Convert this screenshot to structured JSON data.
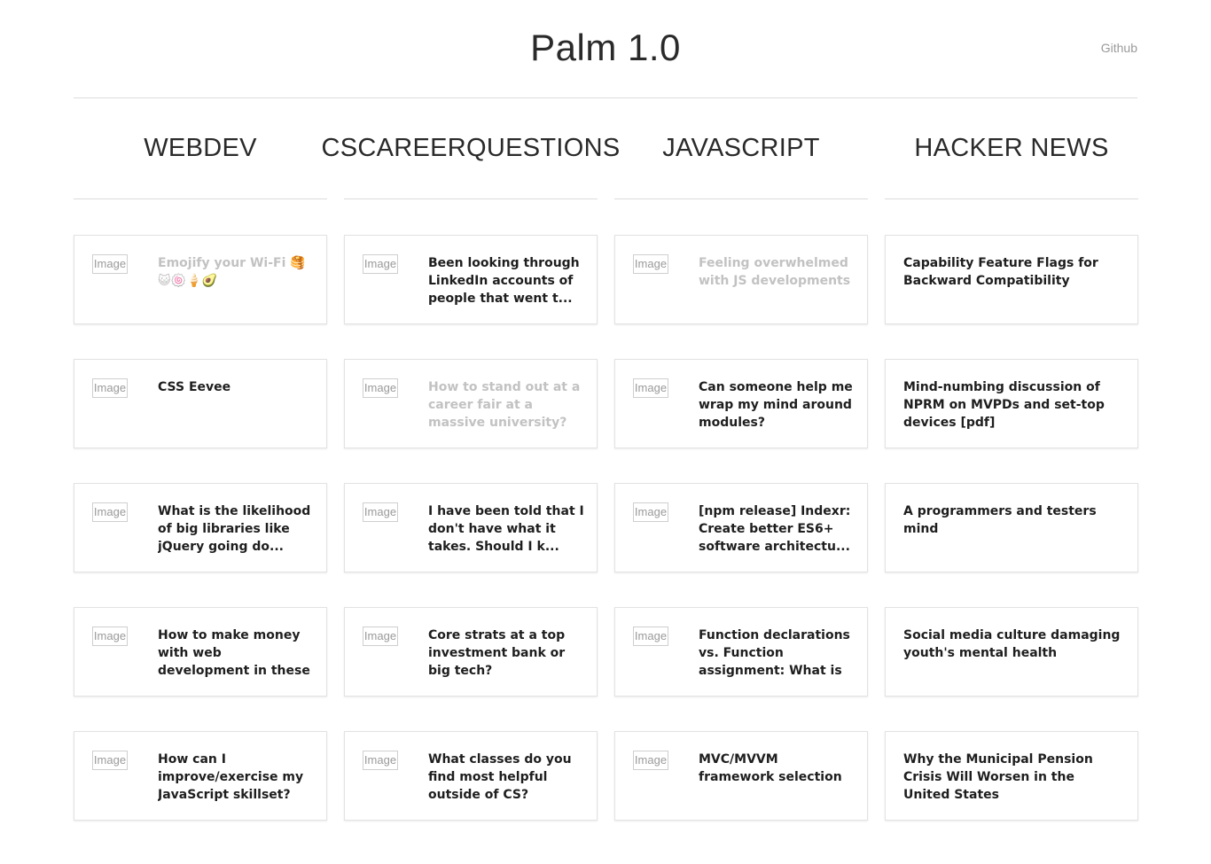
{
  "header": {
    "title": "Palm 1.0",
    "github_label": "Github"
  },
  "columns": [
    {
      "name": "WEBDEV",
      "posts": [
        {
          "thumb": "Image",
          "title": "Emojify your Wi-Fi 🥞😺🍥🍦🥑",
          "visited": true
        },
        {
          "thumb": "Image",
          "title": "CSS Eevee",
          "visited": false
        },
        {
          "thumb": "Image",
          "title": "What is the likelihood of big libraries like jQuery going do...",
          "visited": false
        },
        {
          "thumb": "Image",
          "title": "How to make money with web development in these current time...",
          "visited": false
        },
        {
          "thumb": "Image",
          "title": "How can I improve/exercise my JavaScript skillset?",
          "visited": false
        }
      ]
    },
    {
      "name": "CSCAREERQUESTIONS",
      "posts": [
        {
          "thumb": "Image",
          "title": "Been looking through LinkedIn accounts of people that went t...",
          "visited": false
        },
        {
          "thumb": "Image",
          "title": "How to stand out at a career fair at a massive university?",
          "visited": true
        },
        {
          "thumb": "Image",
          "title": "I have been told that I don't have what it takes. Should I k...",
          "visited": false
        },
        {
          "thumb": "Image",
          "title": "Core strats at a top investment bank or big tech?",
          "visited": false
        },
        {
          "thumb": "Image",
          "title": "What classes do you find most helpful outside of CS?",
          "visited": false
        }
      ]
    },
    {
      "name": "JAVASCRIPT",
      "posts": [
        {
          "thumb": "Image",
          "title": "Feeling overwhelmed with JS developments",
          "visited": true
        },
        {
          "thumb": "Image",
          "title": "Can someone help me wrap my mind around modules?",
          "visited": false
        },
        {
          "thumb": "Image",
          "title": "[npm release] Indexr: Create better ES6+ software architectu...",
          "visited": false
        },
        {
          "thumb": "Image",
          "title": "Function declarations vs. Function assignment: What is your ...",
          "visited": false
        },
        {
          "thumb": "Image",
          "title": "MVC/MVVM framework selection",
          "visited": false
        }
      ]
    },
    {
      "name": "HACKER NEWS",
      "posts": [
        {
          "thumb": "",
          "title": "Capability Feature Flags for Backward Compatibility",
          "visited": false
        },
        {
          "thumb": "",
          "title": "Mind-numbing discussion of NPRM on MVPDs and set-top devices [pdf]",
          "visited": false
        },
        {
          "thumb": "",
          "title": "A programmers and testers mind",
          "visited": false
        },
        {
          "thumb": "",
          "title": "Social media culture damaging youth's mental health",
          "visited": false
        },
        {
          "thumb": "",
          "title": "Why the Municipal Pension Crisis Will Worsen in the United States",
          "visited": false
        }
      ]
    }
  ]
}
